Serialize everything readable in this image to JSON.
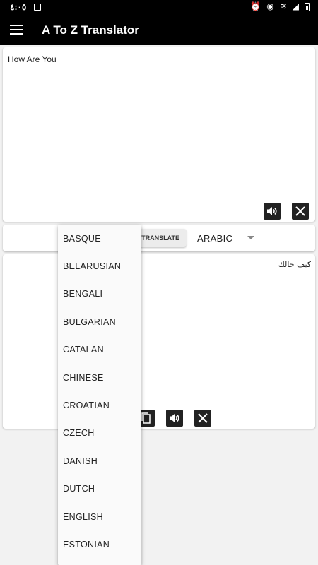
{
  "status_bar": {
    "time": "٤:٠٥"
  },
  "app_bar": {
    "title": "A To Z Translator"
  },
  "input": {
    "text": "How Are You"
  },
  "controls": {
    "translate_label": "TRANSLATE",
    "target_language": "ARABIC"
  },
  "output": {
    "text": "كيف حالك"
  },
  "dropdown": {
    "items": [
      "BASQUE",
      "BELARUSIAN",
      "BENGALI",
      "BULGARIAN",
      "CATALAN",
      "CHINESE",
      "CROATIAN",
      "CZECH",
      "DANISH",
      "DUTCH",
      "ENGLISH",
      "ESTONIAN"
    ]
  },
  "icons": {
    "menu": "menu-icon",
    "speaker": "speaker-icon",
    "close": "close-icon",
    "copy": "copy-icon",
    "dropdown_arrow": "dropdown-arrow-icon"
  },
  "colors": {
    "app_bar": "#000000",
    "background": "#f2f2f2",
    "icon_button": "#222222"
  }
}
